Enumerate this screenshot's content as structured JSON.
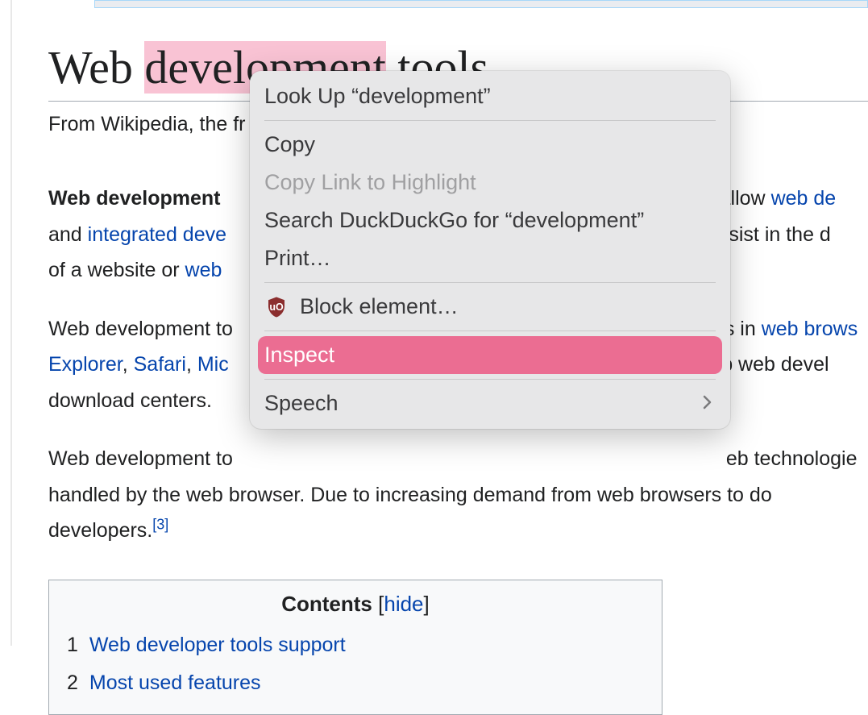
{
  "page": {
    "title_part1": "Web ",
    "title_highlight": "development",
    "title_part2": " tools",
    "subtitle": "From Wikipedia, the fr"
  },
  "para1": {
    "bold": "Web development ",
    "t1": "t) allow ",
    "link1": "web de",
    "t2": " and ",
    "link2": "integrated deve",
    "t3": " assist in the d",
    "t4": " of a website or ",
    "link3": "web "
  },
  "para2": {
    "t1": "Web development to",
    "t2": "s in ",
    "link1": "web brows",
    "link2": "Explorer",
    "sep1": ", ",
    "link3": "Safari",
    "sep2": ", ",
    "link4": "Mic",
    "t3": "elp web devel",
    "t4": " download centers."
  },
  "para3": {
    "t1": "Web development to",
    "t2": "eb technologie",
    "t3": " handled by the web browser. Due to increasing demand from web browsers to do ",
    "t4": " developers.",
    "ref": "[3]"
  },
  "toc": {
    "title": "Contents",
    "bracket_open": " [",
    "hide": "hide",
    "bracket_close": "]",
    "items": [
      {
        "num": "1",
        "label": "Web developer tools support"
      },
      {
        "num": "2",
        "label": "Most used features"
      }
    ]
  },
  "context_menu": {
    "look_up": "Look Up “development”",
    "copy": "Copy",
    "copy_link": "Copy Link to Highlight",
    "search": "Search DuckDuckGo for “development”",
    "print": "Print…",
    "block": "Block element…",
    "inspect": "Inspect",
    "speech": "Speech"
  }
}
